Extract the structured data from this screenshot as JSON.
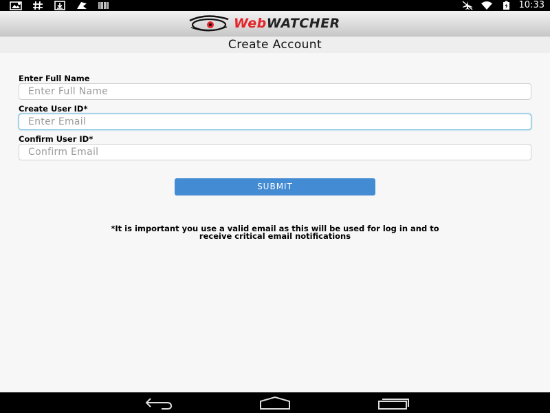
{
  "status_bar": {
    "time": "10:33",
    "left_icons": [
      "screenshot-notification-icon",
      "hash-icon",
      "download-icon",
      "flag-icon",
      "barcode-icon"
    ],
    "right_icons": [
      "airplane-mode-icon",
      "wifi-icon",
      "battery-icon"
    ]
  },
  "header": {
    "logo_part1": "Web",
    "logo_part2": "WATCHER",
    "title": "Create Account"
  },
  "form": {
    "full_name": {
      "label": "Enter Full Name",
      "placeholder": "Enter Full Name",
      "value": ""
    },
    "user_id": {
      "label": "Create User ID*",
      "placeholder": "Enter Email",
      "value": ""
    },
    "confirm_id": {
      "label": "Confirm User ID*",
      "placeholder": "Confirm Email",
      "value": ""
    },
    "submit_label": "SUBMIT"
  },
  "notice": {
    "line1": "*It is important you use a valid email as this will be used for log in and to",
    "line2": "receive critical email notifications"
  },
  "nav_bar": {
    "buttons": [
      "back-icon",
      "home-icon",
      "recent-apps-icon"
    ]
  },
  "colors": {
    "accent_button": "#438bd2",
    "logo_red": "#e5232b",
    "focus_border": "#6fb7d9"
  }
}
